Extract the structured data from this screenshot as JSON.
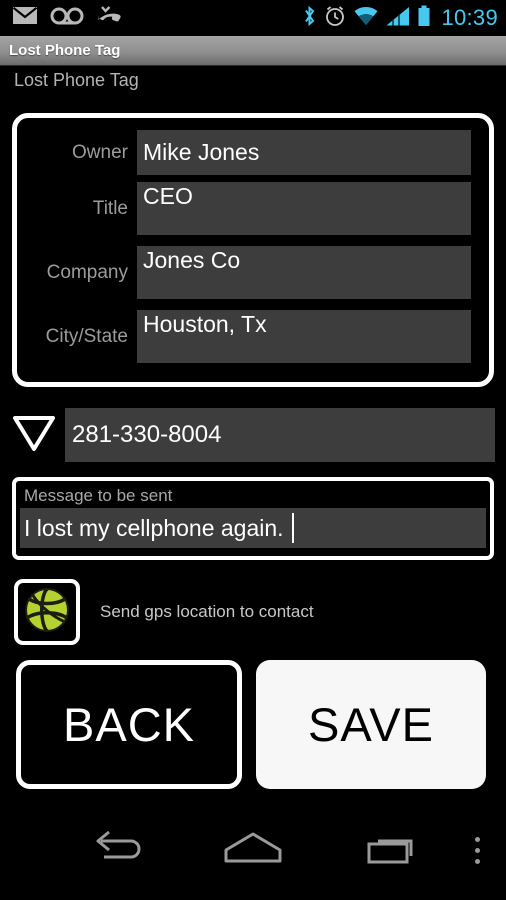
{
  "statusbar": {
    "icons_left": [
      "mail-icon",
      "voicemail-icon",
      "missed-call-icon"
    ],
    "icons_right": [
      "bluetooth-icon",
      "alarm-icon",
      "wifi-icon",
      "signal-icon",
      "battery-icon"
    ],
    "time": "10:39",
    "accent_color": "#46c8f0"
  },
  "titlebar": {
    "title": "Lost Phone Tag"
  },
  "page": {
    "subtitle": "Lost Phone Tag"
  },
  "contact_card": {
    "fields": [
      {
        "label": "Owner",
        "value": "Mike Jones"
      },
      {
        "label": "Title",
        "value": "CEO"
      },
      {
        "label": "Company",
        "value": "Jones Co"
      },
      {
        "label": "City/State",
        "value": "Houston, Tx"
      }
    ]
  },
  "phone": {
    "spinner_icon": "triangle-down-icon",
    "value": "281-330-8004"
  },
  "message": {
    "label": "Message to be sent",
    "value": "I lost my cellphone again. "
  },
  "gps": {
    "icon": "gps-globe-icon",
    "label": "Send gps location to contact",
    "icon_color": "#b4d330"
  },
  "buttons": {
    "back_label": "BACK",
    "save_label": "SAVE"
  },
  "navbar": {
    "back": "nav-back-icon",
    "home": "nav-home-icon",
    "recents": "nav-recents-icon",
    "menu": "nav-overflow-icon"
  }
}
